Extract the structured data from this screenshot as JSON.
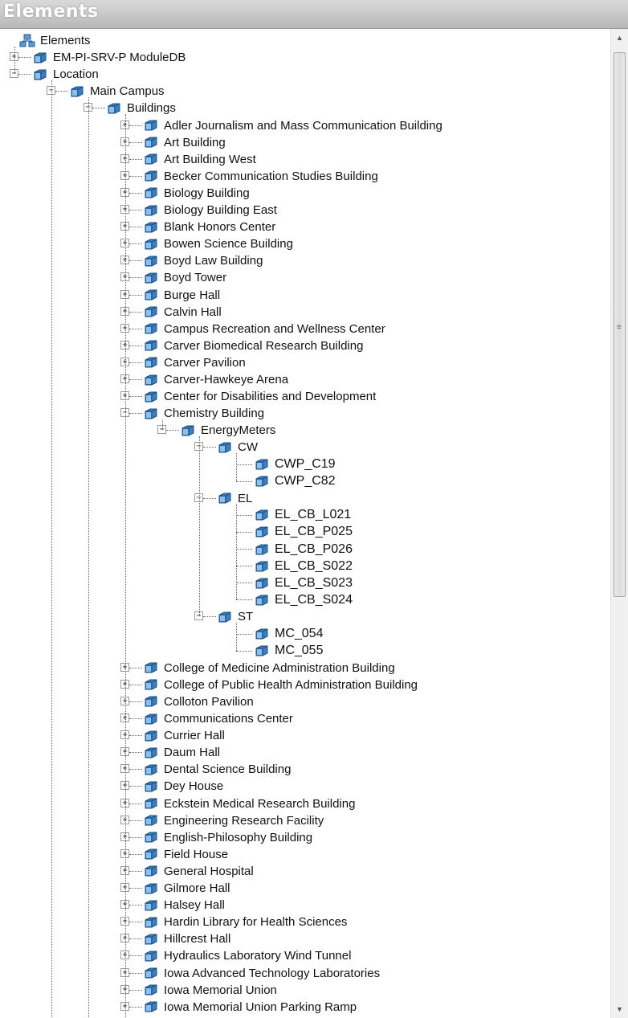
{
  "panel_title": "Elements",
  "root": "Elements",
  "nodes": [
    {
      "label": "EM-PI-SRV-P ModuleDB",
      "depth": 1,
      "state": "collapsed"
    },
    {
      "label": "Location",
      "depth": 1,
      "state": "expanded"
    },
    {
      "label": "Main Campus",
      "depth": 2,
      "state": "expanded"
    },
    {
      "label": "Buildings",
      "depth": 3,
      "state": "expanded"
    },
    {
      "label": "Adler Journalism and Mass Communication Building",
      "depth": 4,
      "state": "collapsed"
    },
    {
      "label": "Art Building",
      "depth": 4,
      "state": "collapsed"
    },
    {
      "label": "Art Building West",
      "depth": 4,
      "state": "collapsed"
    },
    {
      "label": "Becker Communication Studies Building",
      "depth": 4,
      "state": "collapsed"
    },
    {
      "label": "Biology Building",
      "depth": 4,
      "state": "collapsed"
    },
    {
      "label": "Biology Building East",
      "depth": 4,
      "state": "collapsed"
    },
    {
      "label": "Blank Honors Center",
      "depth": 4,
      "state": "collapsed"
    },
    {
      "label": "Bowen Science Building",
      "depth": 4,
      "state": "collapsed"
    },
    {
      "label": "Boyd Law Building",
      "depth": 4,
      "state": "collapsed"
    },
    {
      "label": "Boyd Tower",
      "depth": 4,
      "state": "collapsed"
    },
    {
      "label": "Burge Hall",
      "depth": 4,
      "state": "collapsed"
    },
    {
      "label": "Calvin Hall",
      "depth": 4,
      "state": "collapsed"
    },
    {
      "label": "Campus Recreation and Wellness Center",
      "depth": 4,
      "state": "collapsed"
    },
    {
      "label": "Carver Biomedical Research Building",
      "depth": 4,
      "state": "collapsed"
    },
    {
      "label": "Carver Pavilion",
      "depth": 4,
      "state": "collapsed"
    },
    {
      "label": "Carver-Hawkeye Arena",
      "depth": 4,
      "state": "collapsed"
    },
    {
      "label": "Center for Disabilities and Development",
      "depth": 4,
      "state": "collapsed"
    },
    {
      "label": "Chemistry Building",
      "depth": 4,
      "state": "expanded"
    },
    {
      "label": "EnergyMeters",
      "depth": 5,
      "state": "expanded"
    },
    {
      "label": "CW",
      "depth": 6,
      "state": "expanded"
    },
    {
      "label": "CWP_C19",
      "depth": 7,
      "state": "leaf"
    },
    {
      "label": "CWP_C82",
      "depth": 7,
      "state": "leaf"
    },
    {
      "label": "EL",
      "depth": 6,
      "state": "expanded"
    },
    {
      "label": "EL_CB_L021",
      "depth": 7,
      "state": "leaf"
    },
    {
      "label": "EL_CB_P025",
      "depth": 7,
      "state": "leaf"
    },
    {
      "label": "EL_CB_P026",
      "depth": 7,
      "state": "leaf"
    },
    {
      "label": "EL_CB_S022",
      "depth": 7,
      "state": "leaf"
    },
    {
      "label": "EL_CB_S023",
      "depth": 7,
      "state": "leaf"
    },
    {
      "label": "EL_CB_S024",
      "depth": 7,
      "state": "leaf"
    },
    {
      "label": "ST",
      "depth": 6,
      "state": "expanded"
    },
    {
      "label": "MC_054",
      "depth": 7,
      "state": "leaf"
    },
    {
      "label": "MC_055",
      "depth": 7,
      "state": "leaf"
    },
    {
      "label": "College of Medicine Administration Building",
      "depth": 4,
      "state": "collapsed"
    },
    {
      "label": "College of Public Health Administration Building",
      "depth": 4,
      "state": "collapsed"
    },
    {
      "label": "Colloton Pavilion",
      "depth": 4,
      "state": "collapsed"
    },
    {
      "label": "Communications Center",
      "depth": 4,
      "state": "collapsed"
    },
    {
      "label": "Currier Hall",
      "depth": 4,
      "state": "collapsed"
    },
    {
      "label": "Daum Hall",
      "depth": 4,
      "state": "collapsed"
    },
    {
      "label": "Dental Science Building",
      "depth": 4,
      "state": "collapsed"
    },
    {
      "label": "Dey House",
      "depth": 4,
      "state": "collapsed"
    },
    {
      "label": "Eckstein Medical Research Building",
      "depth": 4,
      "state": "collapsed"
    },
    {
      "label": "Engineering Research Facility",
      "depth": 4,
      "state": "collapsed"
    },
    {
      "label": "English-Philosophy Building",
      "depth": 4,
      "state": "collapsed"
    },
    {
      "label": "Field House",
      "depth": 4,
      "state": "collapsed"
    },
    {
      "label": "General Hospital",
      "depth": 4,
      "state": "collapsed"
    },
    {
      "label": "Gilmore Hall",
      "depth": 4,
      "state": "collapsed"
    },
    {
      "label": "Halsey Hall",
      "depth": 4,
      "state": "collapsed"
    },
    {
      "label": "Hardin Library for Health Sciences",
      "depth": 4,
      "state": "collapsed"
    },
    {
      "label": "Hillcrest Hall",
      "depth": 4,
      "state": "collapsed"
    },
    {
      "label": "Hydraulics Laboratory Wind Tunnel",
      "depth": 4,
      "state": "collapsed"
    },
    {
      "label": "Iowa Advanced Technology Laboratories",
      "depth": 4,
      "state": "collapsed"
    },
    {
      "label": "Iowa Memorial Union",
      "depth": 4,
      "state": "collapsed"
    },
    {
      "label": "Iowa Memorial Union Parking Ramp",
      "depth": 4,
      "state": "collapsed"
    }
  ],
  "icons": {
    "root": "elements-root-icon",
    "node": "element-cube-icon",
    "color": "#3a7fc1"
  },
  "scrollbar": {
    "up": "▲",
    "down": "▼",
    "grip": "≡"
  }
}
